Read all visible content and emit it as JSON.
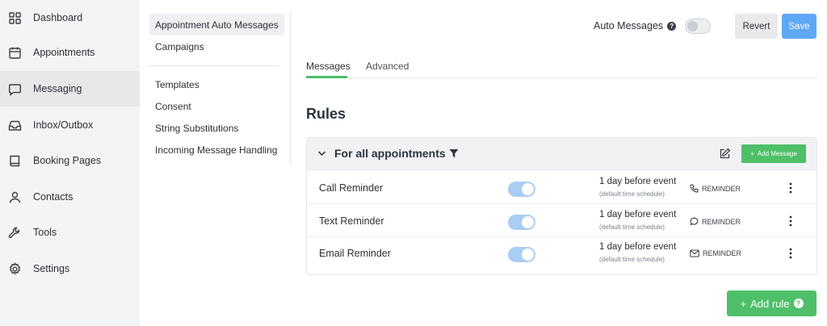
{
  "sidebar": {
    "items": [
      {
        "label": "Dashboard",
        "icon": "dashboard-grid-icon"
      },
      {
        "label": "Appointments",
        "icon": "calendar-icon"
      },
      {
        "label": "Messaging",
        "icon": "chat-bubble-icon",
        "active": true
      },
      {
        "label": "Inbox/Outbox",
        "icon": "inbox-tray-icon"
      },
      {
        "label": "Booking Pages",
        "icon": "book-icon"
      },
      {
        "label": "Contacts",
        "icon": "person-icon"
      },
      {
        "label": "Tools",
        "icon": "wrench-icon"
      },
      {
        "label": "Settings",
        "icon": "gear-icon"
      }
    ]
  },
  "submenu": {
    "items": [
      {
        "label": "Appointment Auto Messages",
        "active": true
      },
      {
        "label": "Campaigns"
      },
      {
        "label": "Templates"
      },
      {
        "label": "Consent"
      },
      {
        "label": "String Substitutions"
      },
      {
        "label": "Incoming Message Handling"
      }
    ]
  },
  "header": {
    "auto_messages_label": "Auto Messages",
    "help_glyph": "?",
    "auto_messages_enabled": false,
    "revert_label": "Revert",
    "save_label": "Save"
  },
  "tabs": [
    {
      "label": "Messages",
      "active": true
    },
    {
      "label": "Advanced"
    }
  ],
  "rules": {
    "title": "Rules",
    "group_title": "For all appointments",
    "add_message_label": "Add Message",
    "rows": [
      {
        "name": "Call Reminder",
        "enabled": true,
        "timing": "1 day before event",
        "schedule": "(default time schedule)",
        "channel_icon": "phone-icon",
        "type": "REMINDER"
      },
      {
        "name": "Text Reminder",
        "enabled": true,
        "timing": "1 day before event",
        "schedule": "(default time schedule)",
        "channel_icon": "chat-bubble-icon",
        "type": "REMINDER"
      },
      {
        "name": "Email Reminder",
        "enabled": true,
        "timing": "1 day before event",
        "schedule": "(default time schedule)",
        "channel_icon": "envelope-icon",
        "type": "REMINDER"
      }
    ],
    "add_rule_label": "Add rule"
  },
  "colors": {
    "accent_green": "#4fbf6a",
    "save_blue": "#5fa8f5",
    "toggle_on": "#a9cdf3",
    "sidebar_bg": "#f3f4f5"
  }
}
